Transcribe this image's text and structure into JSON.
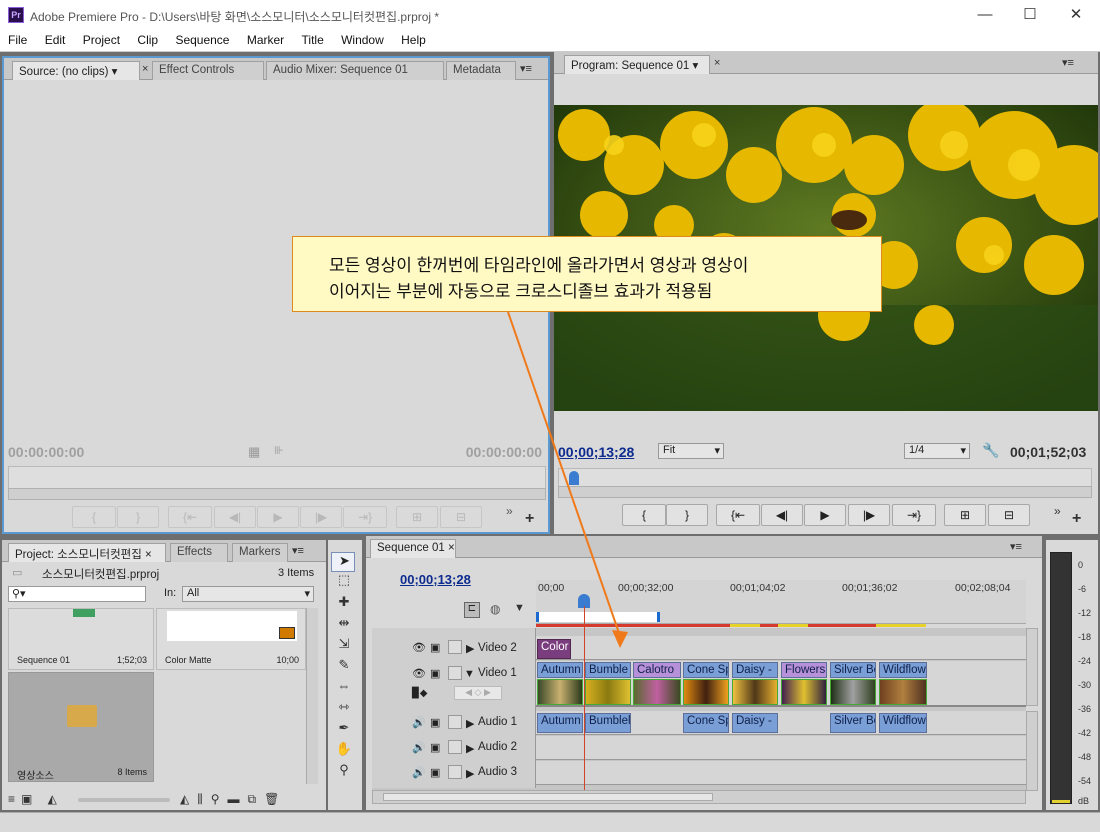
{
  "window": {
    "title": "Adobe Premiere Pro - D:\\Users\\바탕 화면\\소스모니터\\소스모니터컷편집.prproj *",
    "icon": "Pr",
    "controls": [
      "—",
      "☐",
      "✕"
    ]
  },
  "menu": [
    "File",
    "Edit",
    "Project",
    "Clip",
    "Sequence",
    "Marker",
    "Title",
    "Window",
    "Help"
  ],
  "source": {
    "tabs": [
      "Source: (no clips)",
      "Effect Controls",
      "Audio Mixer: Sequence 01",
      "Metadata"
    ],
    "tc_in": "00:00:00:00",
    "tc_out": "00:00:00:00"
  },
  "program": {
    "tab": "Program: Sequence 01",
    "tc": "00;00;13;28",
    "fit": "Fit",
    "res": "1/4",
    "duration": "00;01;52;03"
  },
  "callout": {
    "line1": "모든 영상이 한꺼번에 타임라인에 올라가면서 영상과 영상이",
    "line2": "이어지는 부분에 자동으로 크로스디졸브 효과가 적용됨"
  },
  "project": {
    "tabs": [
      "Project: 소스모니터컷편집",
      "Effects",
      "Markers"
    ],
    "file": "소스모니터컷편집.prproj",
    "count": "3 Items",
    "in_label": "In:",
    "in_value": "All",
    "items": [
      {
        "name": "Sequence 01",
        "dur": "1;52;03"
      },
      {
        "name": "Color Matte",
        "dur": "10;00"
      },
      {
        "name": "영상소스",
        "dur": "8 Items"
      }
    ]
  },
  "timeline": {
    "tab": "Sequence 01",
    "tc": "00;00;13;28",
    "ruler": [
      "00;00",
      "00;00;32;00",
      "00;01;04;02",
      "00;01;36;02",
      "00;02;08;04"
    ],
    "tracks": [
      "Video 2",
      "Video 1",
      "Audio 1",
      "Audio 2",
      "Audio 3"
    ],
    "v2clips": [
      "Color"
    ],
    "v1clips": [
      "Autumn",
      "Bumble",
      "Calotro",
      "Cone Sp",
      "Daisy - ",
      "Flowers",
      "Silver Be",
      "Wildflow"
    ],
    "a1clips": [
      "Autumn",
      "Bumblel",
      "Cone Sp",
      "Daisy - ",
      "Silver Be",
      "Wildflow"
    ]
  },
  "vu": [
    "0",
    "-6",
    "-12",
    "-18",
    "-24",
    "-30",
    "-36",
    "-42",
    "-48",
    "-54",
    "dB"
  ]
}
